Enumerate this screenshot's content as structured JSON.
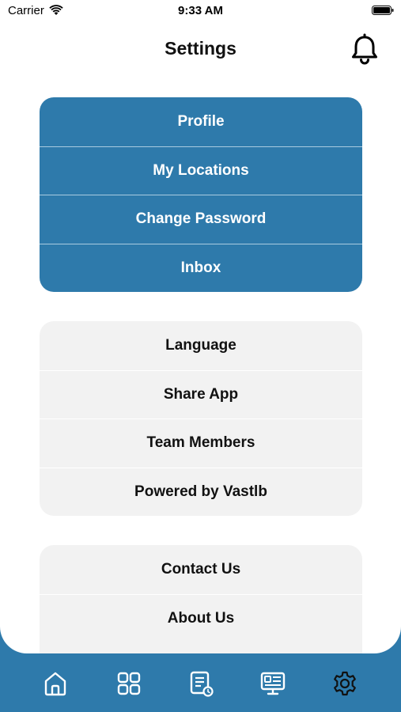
{
  "status_bar": {
    "carrier": "Carrier",
    "time": "9:33 AM"
  },
  "header": {
    "title": "Settings",
    "bell_icon": "bell-icon"
  },
  "account_menu": {
    "items": [
      {
        "label": "Profile"
      },
      {
        "label": "My Locations"
      },
      {
        "label": "Change Password"
      },
      {
        "label": "Inbox"
      }
    ]
  },
  "app_menu": {
    "items": [
      {
        "label": "Language"
      },
      {
        "label": "Share App"
      },
      {
        "label": "Team Members"
      },
      {
        "label": "Powered by Vastlb"
      }
    ]
  },
  "info_menu": {
    "items": [
      {
        "label": "Contact Us"
      },
      {
        "label": "About Us"
      }
    ]
  },
  "tab_bar": {
    "tabs": [
      {
        "icon": "home-icon",
        "active": false
      },
      {
        "icon": "grid-icon",
        "active": false
      },
      {
        "icon": "document-clock-icon",
        "active": false
      },
      {
        "icon": "monitor-profile-icon",
        "active": false
      },
      {
        "icon": "gear-icon",
        "active": true
      }
    ]
  },
  "colors": {
    "primary": "#2e7aab",
    "card_gray": "#f2f2f2",
    "text": "#111111"
  }
}
